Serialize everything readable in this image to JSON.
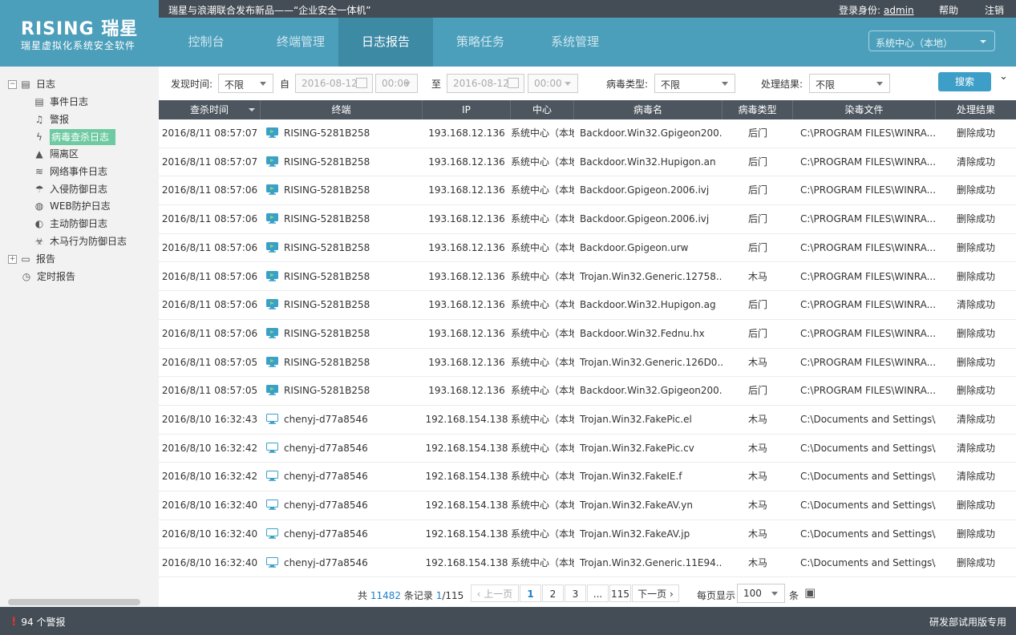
{
  "brand": {
    "logo": "RISING 瑞星",
    "subtitle": "瑞星虚拟化系统安全软件"
  },
  "topbar": {
    "news": "瑞星与浪潮联合发布新品——“企业安全一体机”",
    "login_label": "登录身份:",
    "user": "admin",
    "help": "帮助",
    "logout": "注销"
  },
  "nav": {
    "tabs": [
      "控制台",
      "终端管理",
      "日志报告",
      "策略任务",
      "系统管理"
    ],
    "active": "日志报告",
    "center_select": "系统中心（本地）"
  },
  "sidebar": {
    "root": "日志",
    "items": [
      {
        "label": "事件日志",
        "icon": "document-icon"
      },
      {
        "label": "警报",
        "icon": "bell-icon"
      },
      {
        "label": "病毒查杀日志",
        "icon": "lightning-icon",
        "selected": true
      },
      {
        "label": "隔离区",
        "icon": "quarantine-icon"
      },
      {
        "label": "网络事件日志",
        "icon": "wifi-icon"
      },
      {
        "label": "入侵防御日志",
        "icon": "umbrella-icon"
      },
      {
        "label": "WEB防护日志",
        "icon": "globe-icon"
      },
      {
        "label": "主动防御日志",
        "icon": "shield-icon"
      },
      {
        "label": "木马行为防御日志",
        "icon": "biohazard-icon"
      }
    ],
    "report": "报告",
    "timed_report": "定时报告"
  },
  "filter": {
    "found_time_label": "发现时间:",
    "found_time_value": "不限",
    "from_label": "自",
    "from_date": "2016-08-12",
    "from_time": "00:00",
    "to_label": "至",
    "to_date": "2016-08-12",
    "to_time": "00:00",
    "virus_type_label": "病毒类型:",
    "virus_type_value": "不限",
    "result_label": "处理结果:",
    "result_value": "不限",
    "search": "搜索"
  },
  "table": {
    "columns": [
      "查杀时间",
      "终端",
      "IP",
      "中心",
      "病毒名",
      "病毒类型",
      "染毒文件",
      "处理结果"
    ],
    "rows": [
      [
        "2016/8/11 08:57:07",
        "RISING-5281B258",
        "193.168.12.136",
        "系统中心（本地）",
        "Backdoor.Win32.Gpigeon200...",
        "后门",
        "C:\\PROGRAM FILES\\WINRA...",
        "删除成功"
      ],
      [
        "2016/8/11 08:57:07",
        "RISING-5281B258",
        "193.168.12.136",
        "系统中心（本地）",
        "Backdoor.Win32.Hupigon.an",
        "后门",
        "C:\\PROGRAM FILES\\WINRA...",
        "清除成功"
      ],
      [
        "2016/8/11 08:57:06",
        "RISING-5281B258",
        "193.168.12.136",
        "系统中心（本地）",
        "Backdoor.Gpigeon.2006.ivj",
        "后门",
        "C:\\PROGRAM FILES\\WINRA...",
        "删除成功"
      ],
      [
        "2016/8/11 08:57:06",
        "RISING-5281B258",
        "193.168.12.136",
        "系统中心（本地）",
        "Backdoor.Gpigeon.2006.ivj",
        "后门",
        "C:\\PROGRAM FILES\\WINRA...",
        "删除成功"
      ],
      [
        "2016/8/11 08:57:06",
        "RISING-5281B258",
        "193.168.12.136",
        "系统中心（本地）",
        "Backdoor.Gpigeon.urw",
        "后门",
        "C:\\PROGRAM FILES\\WINRA...",
        "删除成功"
      ],
      [
        "2016/8/11 08:57:06",
        "RISING-5281B258",
        "193.168.12.136",
        "系统中心（本地）",
        "Trojan.Win32.Generic.12758...",
        "木马",
        "C:\\PROGRAM FILES\\WINRA...",
        "删除成功"
      ],
      [
        "2016/8/11 08:57:06",
        "RISING-5281B258",
        "193.168.12.136",
        "系统中心（本地）",
        "Backdoor.Win32.Hupigon.ag",
        "后门",
        "C:\\PROGRAM FILES\\WINRA...",
        "清除成功"
      ],
      [
        "2016/8/11 08:57:06",
        "RISING-5281B258",
        "193.168.12.136",
        "系统中心（本地）",
        "Backdoor.Win32.Fednu.hx",
        "后门",
        "C:\\PROGRAM FILES\\WINRA...",
        "删除成功"
      ],
      [
        "2016/8/11 08:57:05",
        "RISING-5281B258",
        "193.168.12.136",
        "系统中心（本地）",
        "Trojan.Win32.Generic.126D0...",
        "木马",
        "C:\\PROGRAM FILES\\WINRA...",
        "删除成功"
      ],
      [
        "2016/8/11 08:57:05",
        "RISING-5281B258",
        "193.168.12.136",
        "系统中心（本地）",
        "Backdoor.Win32.Gpigeon200...",
        "后门",
        "C:\\PROGRAM FILES\\WINRA...",
        "删除成功"
      ],
      [
        "2016/8/10 16:32:43",
        "chenyj-d77a8546",
        "192.168.154.138",
        "系统中心（本地）",
        "Trojan.Win32.FakePic.el",
        "木马",
        "C:\\Documents and Settings\\A...",
        "清除成功"
      ],
      [
        "2016/8/10 16:32:42",
        "chenyj-d77a8546",
        "192.168.154.138",
        "系统中心（本地）",
        "Trojan.Win32.FakePic.cv",
        "木马",
        "C:\\Documents and Settings\\A...",
        "清除成功"
      ],
      [
        "2016/8/10 16:32:42",
        "chenyj-d77a8546",
        "192.168.154.138",
        "系统中心（本地）",
        "Trojan.Win32.FakeIE.f",
        "木马",
        "C:\\Documents and Settings\\A...",
        "清除成功"
      ],
      [
        "2016/8/10 16:32:40",
        "chenyj-d77a8546",
        "192.168.154.138",
        "系统中心（本地）",
        "Trojan.Win32.FakeAV.yn",
        "木马",
        "C:\\Documents and Settings\\A...",
        "删除成功"
      ],
      [
        "2016/8/10 16:32:40",
        "chenyj-d77a8546",
        "192.168.154.138",
        "系统中心（本地）",
        "Trojan.Win32.FakeAV.jp",
        "木马",
        "C:\\Documents and Settings\\A...",
        "删除成功"
      ],
      [
        "2016/8/10 16:32:40",
        "chenyj-d77a8546",
        "192.168.154.138",
        "系统中心（本地）",
        "Trojan.Win32.Generic.11E94...",
        "木马",
        "C:\\Documents and Settings\\A...",
        "删除成功"
      ]
    ]
  },
  "pager": {
    "total_prefix": "共",
    "total": "11482",
    "total_suffix": "条记录",
    "page": "1",
    "pages": "/115",
    "prev": "上一页",
    "next": "下一页",
    "numbers": [
      "1",
      "2",
      "3",
      "...",
      "115"
    ],
    "per_page_label": "每页显示",
    "per_page": "100",
    "per_page_unit": "条"
  },
  "status": {
    "alarm_count": "94 个警报",
    "edition": "研发部试用版专用"
  },
  "colors": {
    "accent": "#4c9fbb",
    "dark": "#444d56",
    "selected": "#6fcaa2",
    "link": "#1e7fc6"
  }
}
